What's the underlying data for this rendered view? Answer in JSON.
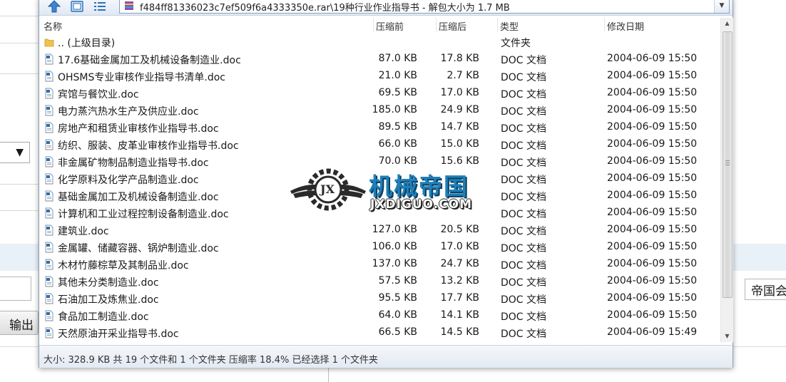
{
  "archive": {
    "path": "f484ff81336023c7ef509f6a4333350e.rar\\19种行业作业指导书 - 解包大小为 1.7 MB",
    "columns": {
      "name": "名称",
      "packed": "压缩前",
      "compressed": "压缩后",
      "type": "类型",
      "modified": "修改日期"
    },
    "parent": {
      "name": ".. (上级目录)",
      "type": "文件夹"
    },
    "files": [
      {
        "name": "17.6基础金属加工及机械设备制造业.doc",
        "packed": "87.0 KB",
        "compressed": "17.8 KB",
        "type": "DOC 文档",
        "modified": "2004-06-09 15:50"
      },
      {
        "name": "OHSMS专业审核作业指导书清单.doc",
        "packed": "21.0 KB",
        "compressed": "2.7 KB",
        "type": "DOC 文档",
        "modified": "2004-06-09 15:50"
      },
      {
        "name": "宾馆与餐饮业.doc",
        "packed": "69.5 KB",
        "compressed": "17.0 KB",
        "type": "DOC 文档",
        "modified": "2004-06-09 15:50"
      },
      {
        "name": "电力蒸汽热水生产及供应业.doc",
        "packed": "185.0 KB",
        "compressed": "24.9 KB",
        "type": "DOC 文档",
        "modified": "2004-06-09 15:50"
      },
      {
        "name": "房地产和租赁业审核作业指导书.doc",
        "packed": "89.5 KB",
        "compressed": "14.7 KB",
        "type": "DOC 文档",
        "modified": "2004-06-09 15:50"
      },
      {
        "name": "纺织、服装、皮革业审核作业指导书.doc",
        "packed": "66.0 KB",
        "compressed": "15.0 KB",
        "type": "DOC 文档",
        "modified": "2004-06-09 15:50"
      },
      {
        "name": "非金属矿物制品制造业指导书.doc",
        "packed": "70.0 KB",
        "compressed": "15.6 KB",
        "type": "DOC 文档",
        "modified": "2004-06-09 15:50"
      },
      {
        "name": "化学原料及化学产品制造业.doc",
        "packed": "",
        "compressed": "",
        "type": "DOC 文档",
        "modified": "2004-06-09 15:50"
      },
      {
        "name": "基础金属加工及机械设备制造业.doc",
        "packed": "",
        "compressed": "",
        "type": "DOC 文档",
        "modified": "2004-06-09 15:50"
      },
      {
        "name": "计算机和工业过程控制设备制造业.doc",
        "packed": "",
        "compressed": "",
        "type": "DOC 文档",
        "modified": "2004-06-09 15:50"
      },
      {
        "name": "建筑业.doc",
        "packed": "127.0 KB",
        "compressed": "20.5 KB",
        "type": "DOC 文档",
        "modified": "2004-06-09 15:50"
      },
      {
        "name": "金属罐、储藏容器、锅炉制造业.doc",
        "packed": "106.0 KB",
        "compressed": "17.0 KB",
        "type": "DOC 文档",
        "modified": "2004-06-09 15:50"
      },
      {
        "name": "木材竹藤棕草及其制品业.doc",
        "packed": "137.0 KB",
        "compressed": "24.7 KB",
        "type": "DOC 文档",
        "modified": "2004-06-09 15:50"
      },
      {
        "name": "其他未分类制造业.doc",
        "packed": "57.5 KB",
        "compressed": "13.2 KB",
        "type": "DOC 文档",
        "modified": "2004-06-09 15:50"
      },
      {
        "name": "石油加工及炼焦业.doc",
        "packed": "95.5 KB",
        "compressed": "17.7 KB",
        "type": "DOC 文档",
        "modified": "2004-06-09 15:50"
      },
      {
        "name": "食品加工制造业.doc",
        "packed": "64.0 KB",
        "compressed": "14.1 KB",
        "type": "DOC 文档",
        "modified": "2004-06-09 15:50"
      },
      {
        "name": "天然原油开采业指导书.doc",
        "packed": "66.5 KB",
        "compressed": "14.5 KB",
        "type": "DOC 文档",
        "modified": "2004-06-09 15:49"
      }
    ],
    "status": "大小: 328.9 KB 共 19 个文件和 1 个文件夹 压缩率 18.4% 已经选择 1 个文件夹"
  },
  "watermark": {
    "title": "机械帝国",
    "subtitle": "JXDIGUO.COM",
    "badge": "JX"
  },
  "background": {
    "button_label": "输出",
    "right_field": "帝国会"
  },
  "icons": {
    "up": "up-arrow-icon",
    "view": "view-icon",
    "list": "list-view-icon",
    "rar": "rar-archive-icon",
    "folder": "folder-icon",
    "doc": "doc-file-icon"
  },
  "colors": {
    "accent": "#2b6fb6",
    "watermark_blue": "#1f7fb8",
    "folder": "#f1c24b"
  }
}
